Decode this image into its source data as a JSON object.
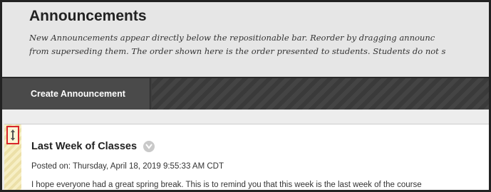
{
  "header": {
    "title": "Announcements",
    "description_line1": "New Announcements appear directly below the repositionable bar. Reorder by dragging announc",
    "description_line2": "from superseding them. The order shown here is the order presented to students. Students do not s"
  },
  "toolbar": {
    "create_label": "Create Announcement"
  },
  "announcement": {
    "title": "Last Week of Classes",
    "posted": "Posted on: Thursday, April 18, 2019 9:55:33 AM CDT",
    "body": "I hope everyone had a great spring break. This is to remind you that this week is the last week of the course",
    "drag_icon": "reorder-arrows-icon",
    "menu_icon": "chevron-down-icon"
  },
  "colors": {
    "toolbar": "#3d3d3d",
    "highlight": "#d9262b",
    "drag_strip": "#f7efc5"
  }
}
